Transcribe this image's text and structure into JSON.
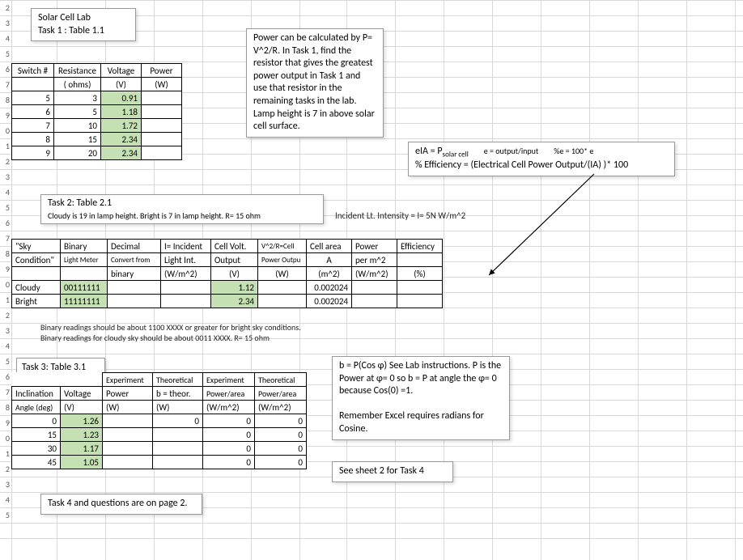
{
  "title_box": {
    "l1": "Solar Cell Lab",
    "l2": "Task 1 :   Table 1.1"
  },
  "task1": {
    "headers": {
      "c1a": "Switch #",
      "c1b": "",
      "c2a": "Resistance",
      "c2b": "( ohms)",
      "c3a": "Voltage",
      "c3b": "(V)",
      "c4a": "Power",
      "c4b": "(W)"
    },
    "rows": [
      {
        "s": "5",
        "r": "3",
        "v": "0.91",
        "p": ""
      },
      {
        "s": "6",
        "r": "5",
        "v": "1.18",
        "p": ""
      },
      {
        "s": "7",
        "r": "10",
        "v": "1.72",
        "p": ""
      },
      {
        "s": "8",
        "r": "15",
        "v": "2.34",
        "p": ""
      },
      {
        "s": "9",
        "r": "20",
        "v": "2.34",
        "p": ""
      }
    ]
  },
  "power_box": "Power can be calculated by P= V^2/R.  In Task 1, find the resistor that gives the greatest power output in Task 1 and use that resistor in the remaining tasks in the lab.\n   Lamp height is 7 in above solar cell surface.",
  "eff_box": {
    "l1_a": "eIA = P",
    "l1_b": "solar cell",
    "l1_c": "e = output/input",
    "l1_d": "%e = 100* e",
    "l2": "% Efficiency = (Electrical Cell Power Output/(IA) )* 100"
  },
  "task2_box": {
    "t": "Task 2: Table 2.1",
    "sub": "Cloudy is 19 in lamp height.  Bright is 7 in lamp height.  R= 15 ohm"
  },
  "incident": "Incident Lt. Intensity =  I= 5N  W/m^2",
  "task2": {
    "h": {
      "c1a": "\"Sky",
      "c1b": "Condition\"",
      "c1c": "",
      "c2a": "Binary",
      "c2b": "Light Meter",
      "c2c": "",
      "c3a": "Decimal",
      "c3b": "Convert from",
      "c3c": "binary",
      "c4a": "I= Incident",
      "c4b": "Light Int.",
      "c4c": "(W/m^2)",
      "c5a": "Cell Volt.",
      "c5b": "Output",
      "c5c": "(V)",
      "c6a": "V^2/R=Cell",
      "c6b": "Power Outpu",
      "c6c": "(W)",
      "c7a": "Cell area",
      "c7b": "A",
      "c7c": "(m^2)",
      "c8a": "Power",
      "c8b": "per m^2",
      "c8c": "(W/m^2)",
      "c9a": "Efficiency",
      "c9b": "",
      "c9c": "(%)"
    },
    "rows": [
      {
        "sky": "Cloudy",
        "bin": "00111111",
        "dec": "",
        "li": "",
        "v": "1.12",
        "pw": "",
        "a": "0.002024",
        "pm": "",
        "eff": ""
      },
      {
        "sky": "Bright",
        "bin": "11111111",
        "dec": "",
        "li": "",
        "v": "2.34",
        "pw": "",
        "a": "0.002024",
        "pm": "",
        "eff": ""
      }
    ]
  },
  "binary_note": {
    "l1": "Binary readings should be  about 1100 XXXX or greater  for bright sky conditions.",
    "l2": "Binary readings for cloudy sky should be about 0011 XXXX.                      R= 15 ohm"
  },
  "task3_title": "Task 3: Table 3.1",
  "task3": {
    "h": {
      "c1a": "",
      "c1b": "Inclination",
      "c1c": "Angle (deg)",
      "c2a": "",
      "c2b": "Voltage",
      "c2c": "(V)",
      "c3a": "Experiment",
      "c3b": "Power",
      "c3c": "(W)",
      "c4a": "Theoretical",
      "c4b": "b = theor.",
      "c4c": "(W)",
      "c5a": "Experiment",
      "c5b": "Power/area",
      "c5c": "(W/m^2)",
      "c6a": "Theoretical",
      "c6b": "Power/area",
      "c6c": "(W/m^2)"
    },
    "rows": [
      {
        "a": "0",
        "v": "1.26",
        "p": "",
        "b": "0",
        "pa": "0",
        "ta": "0"
      },
      {
        "a": "15",
        "v": "1.23",
        "p": "",
        "b": "",
        "pa": "0",
        "ta": "0"
      },
      {
        "a": "30",
        "v": "1.17",
        "p": "",
        "b": "",
        "pa": "0",
        "ta": "0"
      },
      {
        "a": "45",
        "v": "1.05",
        "p": "",
        "b": "",
        "pa": "0",
        "ta": "0"
      }
    ]
  },
  "cos_box": "b = P(Cos φ)  See Lab instructions. P is  the Power at φ= 0 so b = P at angle the φ= 0 because Cos(0) =1.\n\nRemember Excel requires radians for Cosine.",
  "sheet2": "See sheet 2 for Task 4",
  "task4": "Task 4 and questions are on page 2.",
  "rowlabels": [
    "2",
    "3",
    "4",
    "5",
    "6",
    "7",
    "8",
    "9",
    "0",
    "1",
    "2",
    "3",
    "4",
    "5",
    "6",
    "7",
    "8",
    "9",
    "0",
    "1",
    "2",
    "3",
    "4",
    "5",
    "6",
    "7",
    "8",
    "9",
    "0",
    "1",
    "2",
    "3",
    "4",
    "5"
  ]
}
